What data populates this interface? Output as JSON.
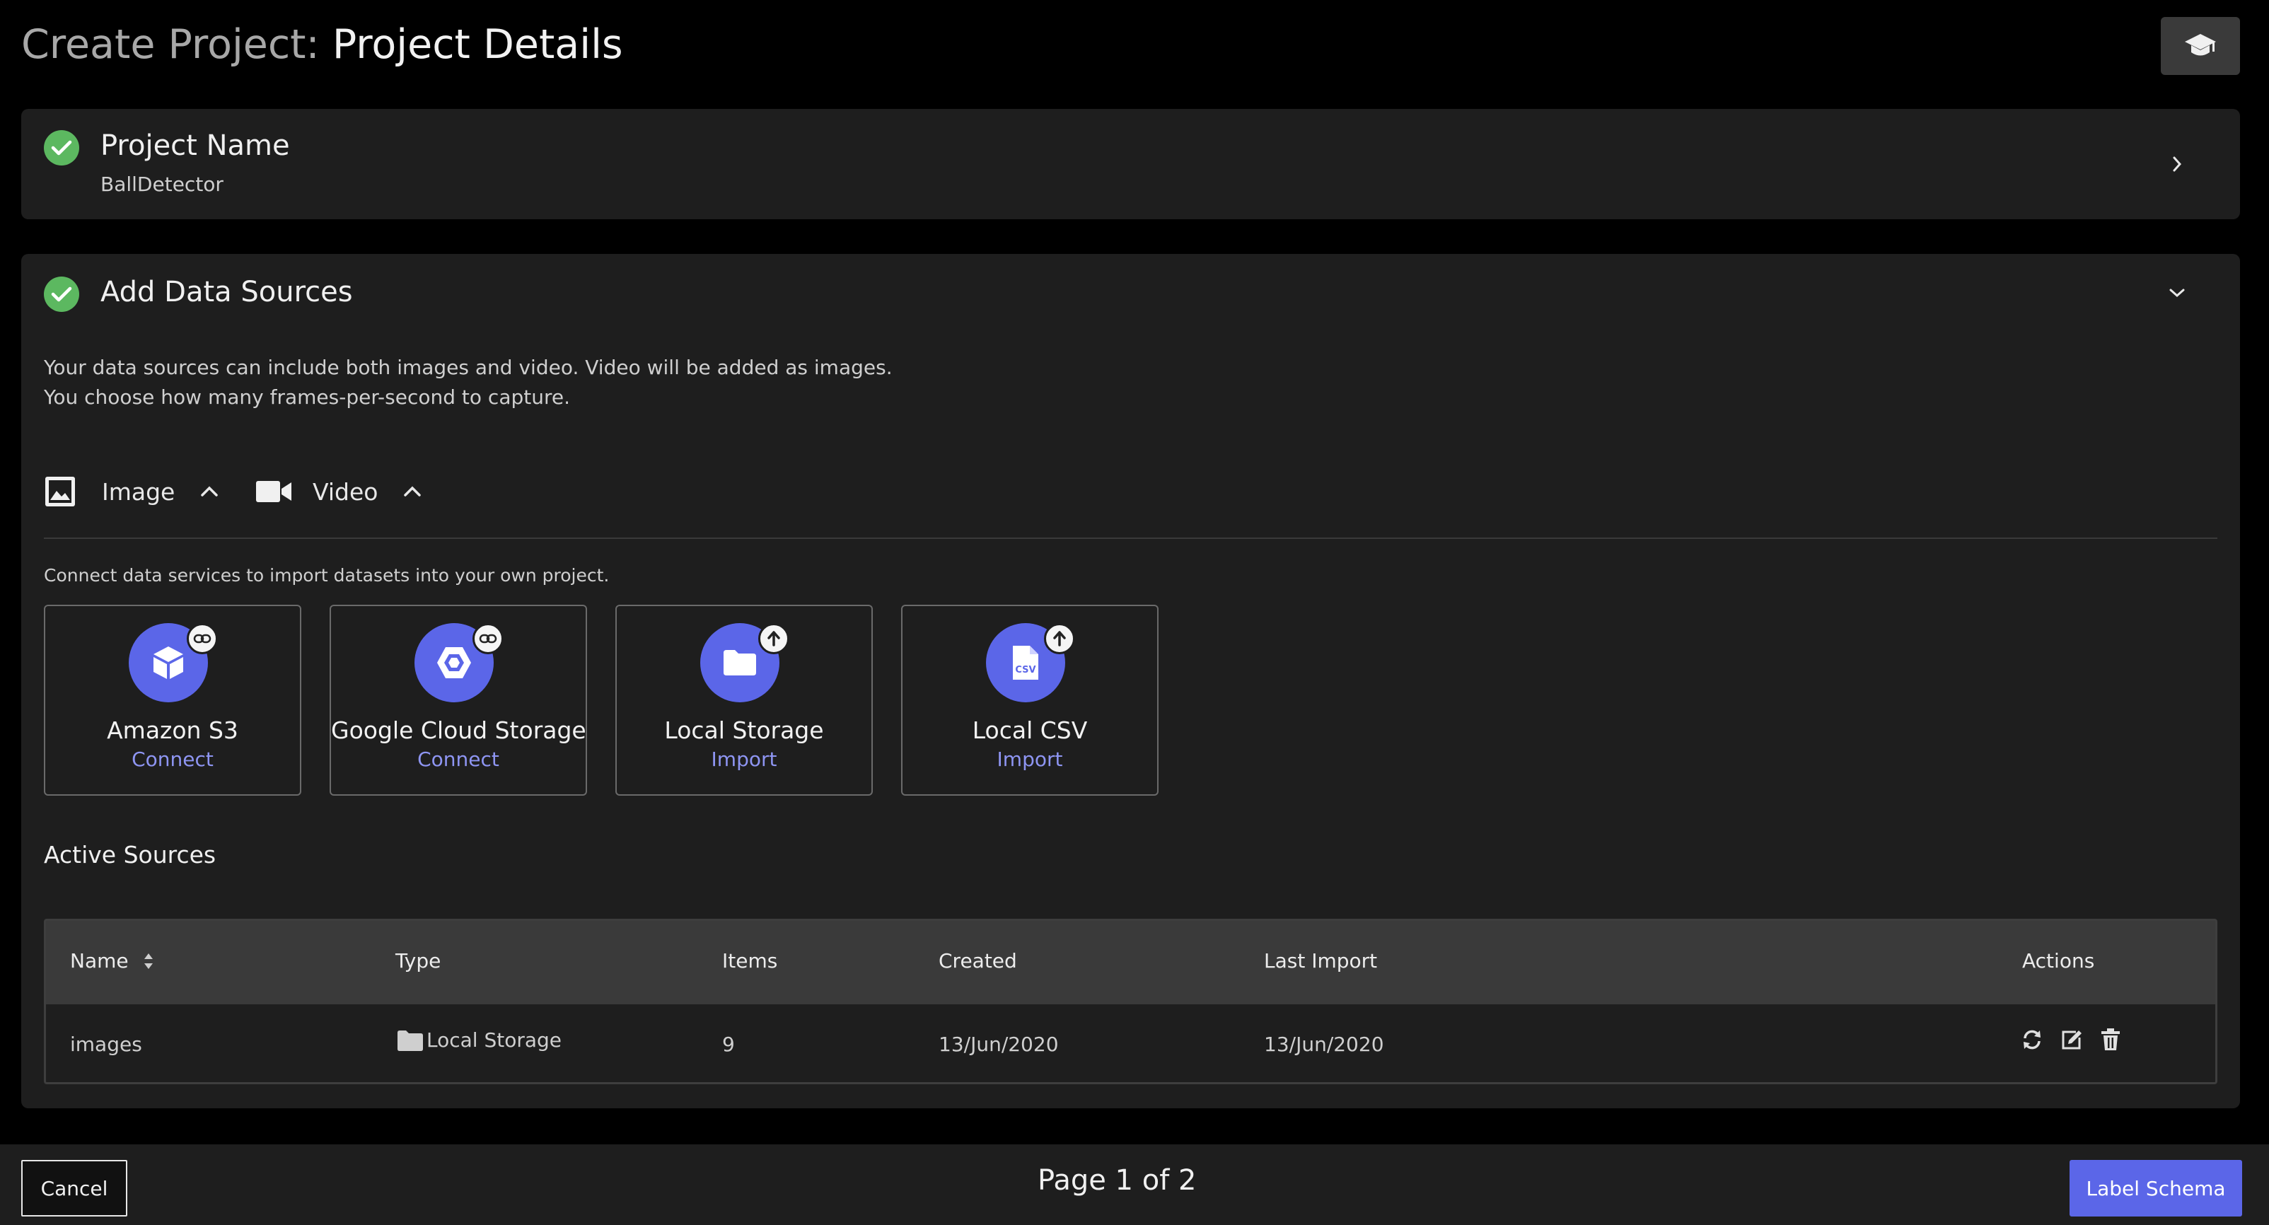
{
  "header": {
    "title_prefix": "Create Project: ",
    "title_main": "Project Details",
    "help_icon": "graduation-cap-icon"
  },
  "project_panel": {
    "title": "Project Name",
    "value": "BallDetector",
    "status_icon": "check-circle-icon",
    "expand_icon": "chevron-right-icon"
  },
  "sources_panel": {
    "title": "Add Data Sources",
    "status_icon": "check-circle-icon",
    "collapse_icon": "chevron-down-icon",
    "description_line1": "Your data sources can include both images and video. Video will be added as images.",
    "description_line2": "You choose how many frames-per-second to capture.",
    "media_types": [
      {
        "label": "Image",
        "icon": "image-icon",
        "toggle_icon": "chevron-up-icon"
      },
      {
        "label": "Video",
        "icon": "video-camera-icon",
        "toggle_icon": "chevron-up-icon"
      }
    ],
    "connect_text": "Connect data services to import datasets into your own project.",
    "services": [
      {
        "name": "Amazon S3",
        "action": "Connect",
        "icon": "cube-icon",
        "badge_icon": "link-icon"
      },
      {
        "name": "Google Cloud Storage",
        "action": "Connect",
        "icon": "google-cloud-icon",
        "badge_icon": "link-icon"
      },
      {
        "name": "Local Storage",
        "action": "Import",
        "icon": "folder-icon",
        "badge_icon": "upload-arrow-icon"
      },
      {
        "name": "Local CSV",
        "action": "Import",
        "icon": "csv-file-icon",
        "badge_icon": "upload-arrow-icon"
      }
    ],
    "active_title": "Active Sources",
    "table": {
      "columns": [
        "Name",
        "Type",
        "Items",
        "Created",
        "Last Import",
        "Actions"
      ],
      "rows": [
        {
          "name": "images",
          "type": "Local Storage",
          "items": "9",
          "created": "13/Jun/2020",
          "last_import": "13/Jun/2020"
        }
      ]
    }
  },
  "footer": {
    "cancel_label": "Cancel",
    "page_indicator": "Page 1 of 2",
    "next_label": "Label Schema"
  },
  "colors": {
    "accent": "#5b66e8",
    "success": "#5cb860",
    "panel": "#1e1e1e",
    "background": "#000000"
  }
}
